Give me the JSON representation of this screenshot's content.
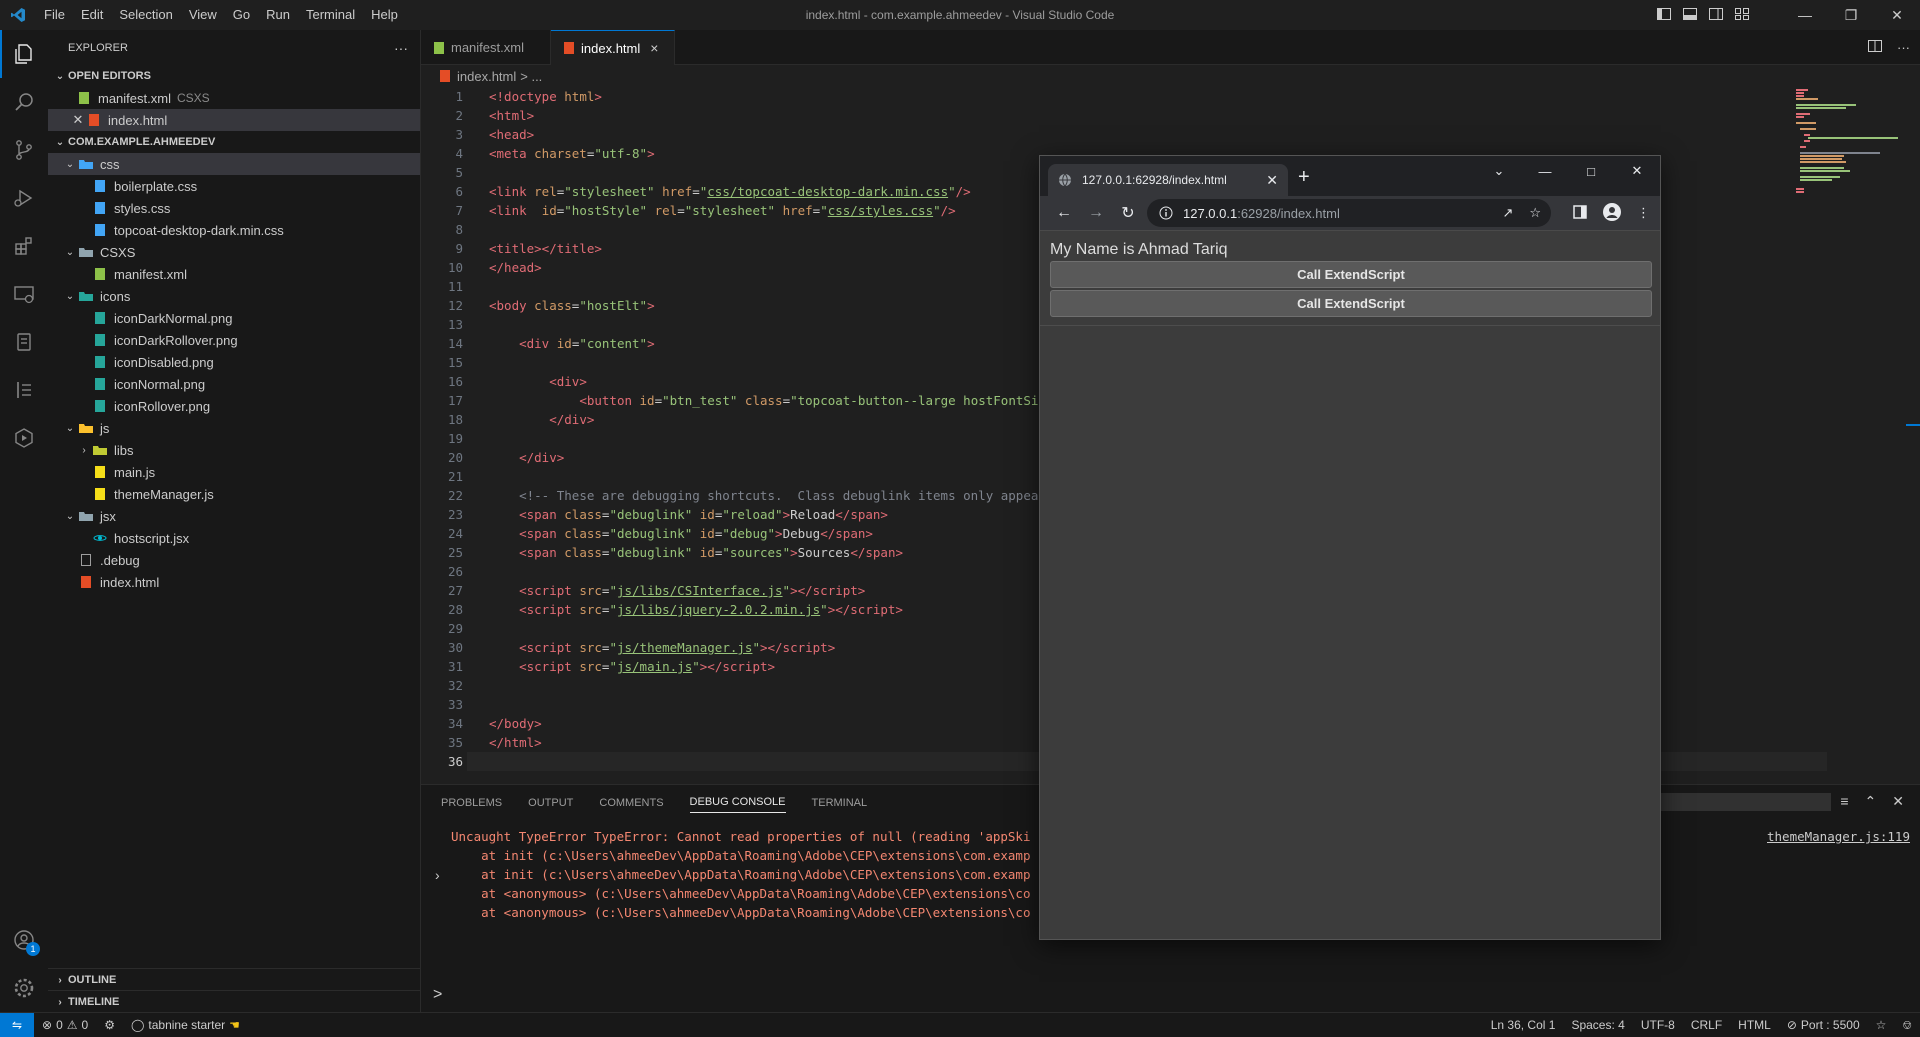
{
  "window": {
    "title": "index.html - com.example.ahmeedev - Visual Studio Code",
    "menu": [
      "File",
      "Edit",
      "Selection",
      "View",
      "Go",
      "Run",
      "Terminal",
      "Help"
    ]
  },
  "explorer": {
    "title": "EXPLORER",
    "more": "···",
    "open_editors_label": "OPEN EDITORS",
    "open_editors": [
      {
        "name": "manifest.xml",
        "desc": "CSXS"
      },
      {
        "name": "index.html",
        "desc": ""
      }
    ],
    "project_label": "COM.EXAMPLE.AHMEEDEV",
    "tree": [
      {
        "name": "css"
      },
      {
        "name": "boilerplate.css"
      },
      {
        "name": "styles.css"
      },
      {
        "name": "topcoat-desktop-dark.min.css"
      },
      {
        "name": "CSXS"
      },
      {
        "name": "manifest.xml"
      },
      {
        "name": "icons"
      },
      {
        "name": "iconDarkNormal.png"
      },
      {
        "name": "iconDarkRollover.png"
      },
      {
        "name": "iconDisabled.png"
      },
      {
        "name": "iconNormal.png"
      },
      {
        "name": "iconRollover.png"
      },
      {
        "name": "js"
      },
      {
        "name": "libs"
      },
      {
        "name": "main.js"
      },
      {
        "name": "themeManager.js"
      },
      {
        "name": "jsx"
      },
      {
        "name": "hostscript.jsx"
      },
      {
        "name": ".debug"
      },
      {
        "name": "index.html"
      }
    ],
    "outline_label": "OUTLINE",
    "timeline_label": "TIMELINE"
  },
  "tabs": [
    {
      "label": "manifest.xml"
    },
    {
      "label": "index.html",
      "close": "×"
    }
  ],
  "breadcrumb": {
    "file": "index.html",
    "rest": "> ..."
  },
  "editor": {
    "current_line": 36,
    "line_numbers": [
      "1",
      "2",
      "3",
      "4",
      "5",
      "6",
      "7",
      "8",
      "9",
      "10",
      "11",
      "12",
      "13",
      "14",
      "15",
      "16",
      "17",
      "18",
      "19",
      "20",
      "21",
      "22",
      "23",
      "24",
      "25",
      "26",
      "27",
      "28",
      "29",
      "30",
      "31",
      "32",
      "33",
      "34",
      "35",
      "36"
    ]
  },
  "panel": {
    "tabs": [
      "PROBLEMS",
      "OUTPUT",
      "COMMENTS",
      "DEBUG CONSOLE",
      "TERMINAL"
    ],
    "active_tab": "DEBUG CONSOLE",
    "errors": [
      "Uncaught TypeError TypeError: Cannot read properties of null (reading 'appSki",
      "    at init (c:\\Users\\ahmeeDev\\AppData\\Roaming\\Adobe\\CEP\\extensions\\com.examp",
      "    at init (c:\\Users\\ahmeeDev\\AppData\\Roaming\\Adobe\\CEP\\extensions\\com.examp",
      "    at <anonymous> (c:\\Users\\ahmeeDev\\AppData\\Roaming\\Adobe\\CEP\\extensions\\co",
      "    at <anonymous> (c:\\Users\\ahmeeDev\\AppData\\Roaming\\Adobe\\CEP\\extensions\\co"
    ],
    "source_link": "themeManager.js:119",
    "prompt": ">"
  },
  "statusbar": {
    "errors": "0",
    "warnings": "0",
    "tabnine": "tabnine starter",
    "position": "Ln 36, Col 1",
    "spaces": "Spaces: 4",
    "encoding": "UTF-8",
    "eol": "CRLF",
    "language": "HTML",
    "port": "Port : 5500"
  },
  "browser": {
    "tab_title": "127.0.0.1:62928/index.html",
    "url_host": "127.0.0.1",
    "url_rest": ":62928/index.html",
    "page_text": "My Name is Ahmad Tariq",
    "buttons": [
      "Call ExtendScript",
      "Call ExtendScript"
    ]
  }
}
